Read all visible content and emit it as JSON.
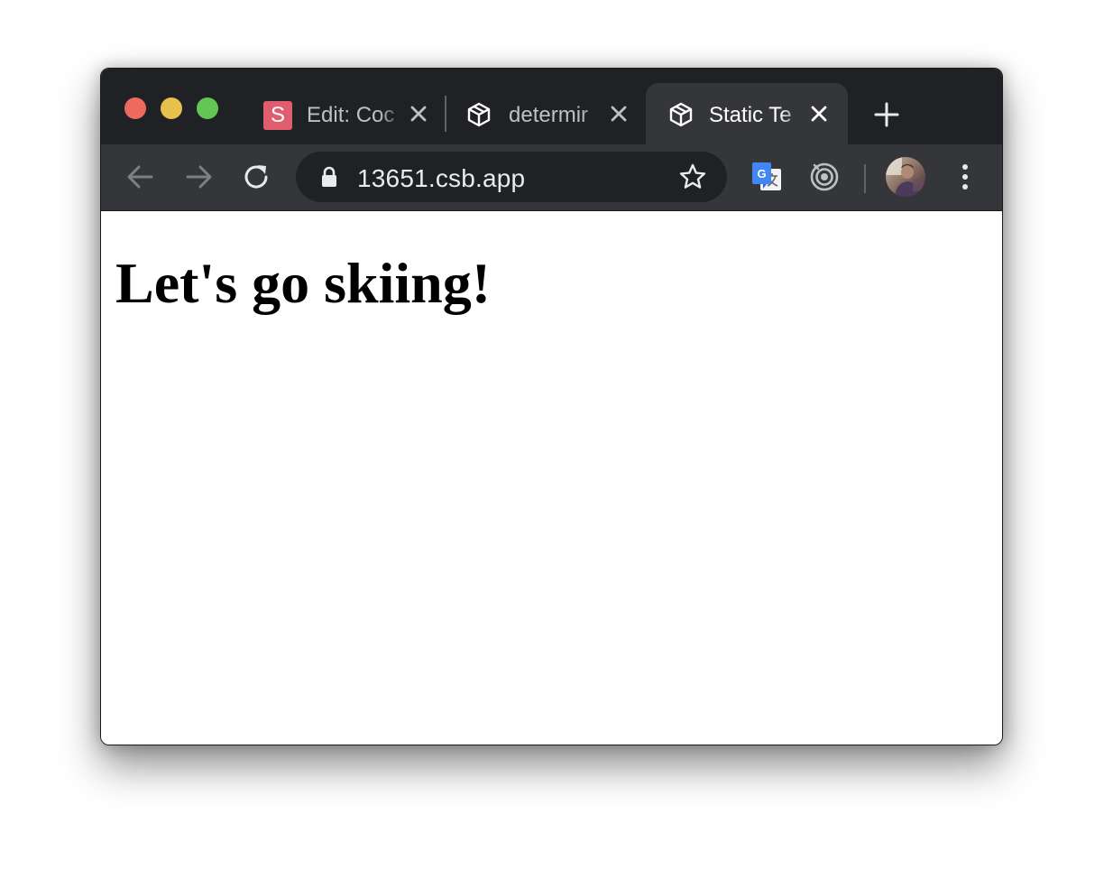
{
  "browser": {
    "window_controls": {
      "close_color": "#ed6a5e",
      "minimize_color": "#e6c14b",
      "maximize_color": "#62c554"
    },
    "tabs": [
      {
        "title": "Edit: Coc",
        "favicon": "s-letter-icon",
        "favicon_letter": "S",
        "favicon_color": "#e05d6f",
        "active": false
      },
      {
        "title": "determir",
        "favicon": "codesandbox-cube-icon",
        "active": false
      },
      {
        "title": "Static Te",
        "favicon": "codesandbox-cube-icon",
        "active": true
      }
    ],
    "new_tab_icon": "plus-icon",
    "toolbar": {
      "back_icon": "arrow-left-icon",
      "forward_icon": "arrow-right-icon",
      "reload_icon": "reload-icon",
      "address": "13651.csb.app",
      "lock_icon": "lock-icon",
      "bookmark_icon": "star-outline-icon",
      "extensions": [
        "google-translate-icon",
        "target-extension-icon"
      ],
      "profile": "avatar",
      "menu_icon": "vertical-dots-icon"
    },
    "colors": {
      "tabstrip_bg": "#202124",
      "toolbar_bg": "#35363a",
      "omnibox_bg": "#202124",
      "inactive_text": "#bdc1c6",
      "active_text": "#ffffff"
    }
  },
  "page": {
    "heading": "Let's go skiing!"
  }
}
